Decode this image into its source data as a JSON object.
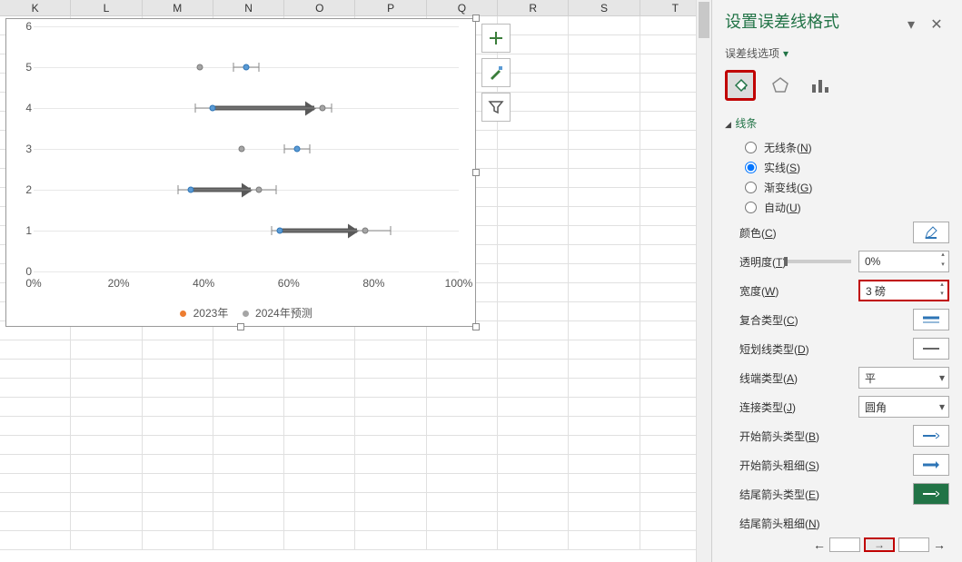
{
  "columns": [
    "K",
    "L",
    "M",
    "N",
    "O",
    "P",
    "Q",
    "R",
    "S",
    "T"
  ],
  "chart_data": {
    "type": "scatter",
    "title": "",
    "xlabel": "",
    "ylabel": "",
    "xlim": [
      0,
      100
    ],
    "ylim": [
      0,
      6
    ],
    "x_ticks": [
      "0%",
      "20%",
      "40%",
      "60%",
      "80%",
      "100%"
    ],
    "y_ticks": [
      "0",
      "1",
      "2",
      "3",
      "4",
      "5",
      "6"
    ],
    "series": [
      {
        "name": "2023年",
        "color": "#5b9bd5",
        "points": [
          {
            "y": 5,
            "x": 50,
            "err": [
              3,
              3
            ]
          },
          {
            "y": 4,
            "x": 42,
            "err": [
              4,
              28
            ]
          },
          {
            "y": 3,
            "x": 62,
            "err": [
              3,
              3
            ]
          },
          {
            "y": 2,
            "x": 37,
            "err": [
              3,
              20
            ]
          },
          {
            "y": 1,
            "x": 58,
            "err": [
              2,
              26
            ]
          }
        ]
      },
      {
        "name": "2024年预测",
        "color": "#a5a5a5",
        "points": [
          {
            "y": 5,
            "x": 39
          },
          {
            "y": 4,
            "x": 68
          },
          {
            "y": 3,
            "x": 49
          },
          {
            "y": 2,
            "x": 53
          },
          {
            "y": 1,
            "x": 78
          }
        ]
      }
    ],
    "arrows": [
      {
        "y": 4,
        "x1": 42,
        "x2": 66
      },
      {
        "y": 2,
        "x1": 37,
        "x2": 51
      },
      {
        "y": 1,
        "x1": 58,
        "x2": 76
      }
    ]
  },
  "legend": {
    "s1": "2023年",
    "s2": "2024年预测"
  },
  "panel": {
    "title": "设置误差线格式",
    "options_label": "误差线选项",
    "section": "线条",
    "radios": {
      "none": "无线条(N)",
      "solid": "实线(S)",
      "gradient": "渐变线(G)",
      "auto": "自动(U)"
    },
    "props": {
      "color": "颜色(C)",
      "transparency": "透明度(T)",
      "transparency_val": "0%",
      "width": "宽度(W)",
      "width_val": "3 磅",
      "compound": "复合类型(C)",
      "dash": "短划线类型(D)",
      "cap": "线端类型(A)",
      "cap_val": "平",
      "join": "连接类型(J)",
      "join_val": "圆角",
      "begin_type": "开始箭头类型(B)",
      "begin_size": "开始箭头粗细(S)",
      "end_type": "结尾箭头类型(E)",
      "end_size": "结尾箭头粗细(N)"
    }
  }
}
